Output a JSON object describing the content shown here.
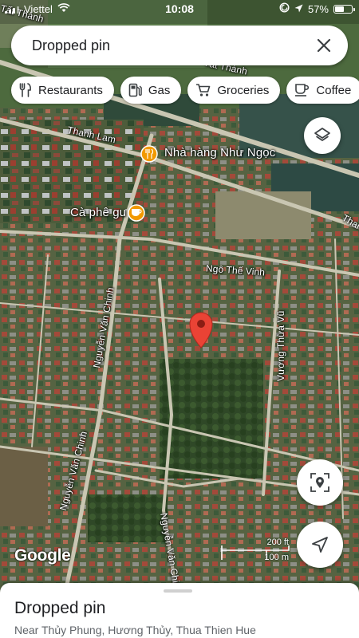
{
  "status_bar": {
    "carrier": "Viettel",
    "time": "10:08",
    "battery": "57%",
    "battery_level": 0.57,
    "icons": [
      "signal-icon",
      "wifi-icon",
      "screen-lock-icon",
      "location-arrow-icon",
      "battery-icon"
    ]
  },
  "search": {
    "query": "Dropped pin",
    "close_icon": "close-icon"
  },
  "chips": [
    {
      "label": "Restaurants",
      "icon": "fork-knife-icon"
    },
    {
      "label": "Gas",
      "icon": "gas-pump-icon"
    },
    {
      "label": "Groceries",
      "icon": "cart-icon"
    },
    {
      "label": "Coffee",
      "icon": "coffee-cup-icon"
    }
  ],
  "map": {
    "places": [
      {
        "name": "Nhà hàng Như Ngọc",
        "icon": "fork-knife-icon",
        "color": "#f29900"
      },
      {
        "name": "Cà phê gu",
        "icon": "coffee-cup-icon",
        "color": "#f29900"
      }
    ],
    "streets": [
      "Thanh Lam",
      "Ngô Thế Vinh",
      "Nguyễn Văn Chinh",
      "Vương Thừa Vũ",
      "Nguyễn Văn Chinh",
      "Nguyễn Văn Chinh",
      "Tất Thành",
      "Tất Thành",
      "Than"
    ],
    "pin_color": "#ea4335",
    "logo": "Google",
    "scale": {
      "feet": "200 ft",
      "meters": "100 m"
    }
  },
  "buttons": {
    "layers_icon": "layers-icon",
    "street_view_icon": "street-view-target-icon",
    "my_location_icon": "navigation-arrow-icon"
  },
  "sheet": {
    "title": "Dropped pin",
    "subtitle": "Near Thủy Phung, Hương Thủy, Thua Thien Hue"
  }
}
